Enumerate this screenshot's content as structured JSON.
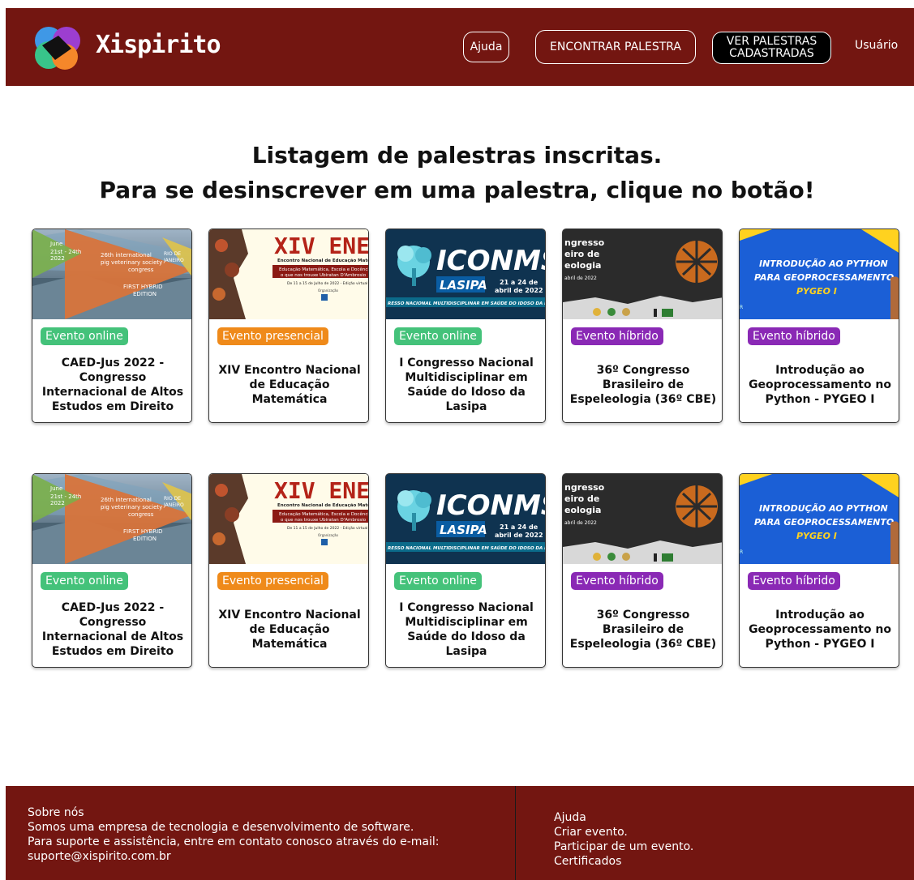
{
  "header": {
    "brand": "Xispirito",
    "nav": {
      "help": "Ajuda",
      "find": "ENCONTRAR PALESTRA",
      "list_line1": "VER PALESTRAS",
      "list_line2": "CADASTRADAS",
      "user": "Usuário"
    }
  },
  "heading": {
    "line1": "Listagem de palestras inscritas.",
    "line2": "Para se desinscrever em uma palestra, clique no botão!"
  },
  "thumb_text": {
    "caed": {
      "date": "June 21st - 24th 2022",
      "congress": "26th international pig veterinary society congress",
      "place": "RIO DE JANEIRO",
      "edition": "FIRST HYBRID EDITION"
    },
    "enem": {
      "title": "XIV ENEM",
      "sub1": "Encontro Nacional de Educação Matemá",
      "sub2": "Educação Matemática, Escola e Docência:",
      "sub3": "o que nos trouxe Ubiratan D'Ambrosio",
      "dates": "De 11 a 15 de Julho de 2022 - Edição virtual",
      "org": "Organização"
    },
    "iconmsi": {
      "title": "ICONMSI",
      "lasipa": "LASIPA",
      "dates1": "21 a 24 de",
      "dates2": "abril de 2022",
      "band": "RESSO NACIONAL MULTIDISCIPLINAR EM SAÚDE DO IDOSO DA LASI"
    },
    "cbe": {
      "l1": "ngresso",
      "l2": "eiro de",
      "l3": "eologia",
      "l4": "abril de 2022"
    },
    "pygeo": {
      "l1": "INTRODUÇÃO AO PYTHON",
      "l2": "PARA GEOPROCESSAMENTO",
      "l3": "PYGEO I"
    }
  },
  "rows": [
    [
      {
        "badge": "Evento online",
        "title": "CAED-Jus 2022 - Congresso Internacional de Altos Estudos em Direito"
      },
      {
        "badge": "Evento presencial",
        "title": "XIV Encontro Nacional de Educação Matemática"
      },
      {
        "badge": "Evento online",
        "title": "I Congresso Nacional Multidisciplinar em Saúde do Idoso da Lasipa"
      },
      {
        "badge": "Evento híbrido",
        "title": "36º Congresso Brasileiro de Espeleologia (36º CBE)"
      },
      {
        "badge": "Evento híbrido",
        "title": "Introdução ao Geoprocessamento no Python - PYGEO I"
      }
    ],
    [
      {
        "badge": "Evento online",
        "title": "CAED-Jus 2022 - Congresso Internacional de Altos Estudos em Direito"
      },
      {
        "badge": "Evento presencial",
        "title": "XIV Encontro Nacional de Educação Matemática"
      },
      {
        "badge": "Evento online",
        "title": "I Congresso Nacional Multidisciplinar em Saúde do Idoso da Lasipa"
      },
      {
        "badge": "Evento híbrido",
        "title": "36º Congresso Brasileiro de Espeleologia (36º CBE)"
      },
      {
        "badge": "Evento híbrido",
        "title": "Introdução ao Geoprocessamento no Python - PYGEO I"
      }
    ]
  ],
  "footer": {
    "about_title": "Sobre nós",
    "about_text": "Somos uma empresa de tecnologia e desenvolvimento de software.",
    "support_text": "Para suporte e assistência, entre em contato conosco através do e-mail:",
    "email": "suporte@xispirito.com.br",
    "links": [
      "Ajuda",
      "Criar evento.",
      "Participar de um evento.",
      "Certificados"
    ]
  },
  "colors": {
    "header_bg": "#731611",
    "online": "#44c27a",
    "presencial": "#ef8a1a",
    "hibrido": "#8a29b5"
  }
}
